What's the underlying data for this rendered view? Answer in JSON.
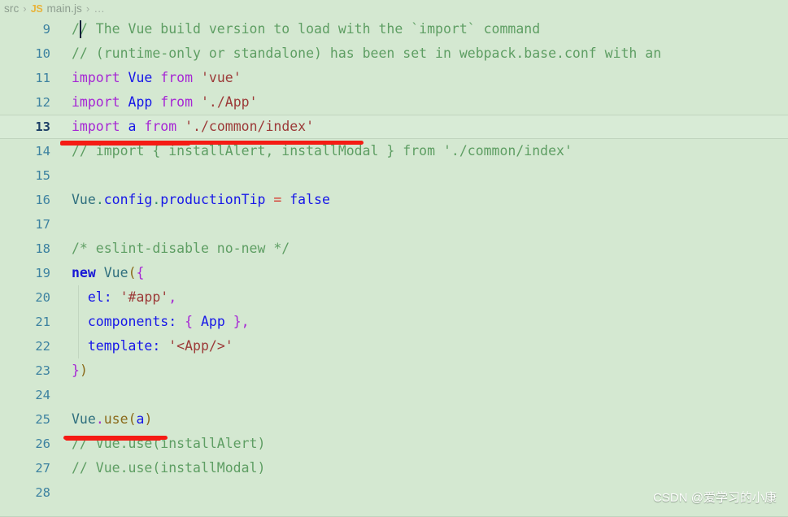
{
  "breadcrumb": {
    "folder": "src",
    "separator": "›",
    "file_icon_label": "JS",
    "file": "main.js",
    "dots": "…"
  },
  "editor": {
    "background_color": "#d4e8d1",
    "active_line_number": 13,
    "first_visible_line": 9,
    "last_visible_line": 28,
    "language": "javascript",
    "cursor": {
      "line": 13,
      "column": 2
    },
    "colors": {
      "comment": "#5e9e63",
      "keyword": "#a626d4",
      "identifier": "#1717e8",
      "string": "#9c3a38",
      "operator": "#d63a2f",
      "paren": "#8a6a1a",
      "line_number": "#3d82a0",
      "annotation_red": "#f51b14"
    },
    "lines": [
      {
        "number": "9",
        "tokens": [
          {
            "text": "// The Vue build version to load with the `import` command",
            "cls": "t-comment"
          }
        ]
      },
      {
        "number": "10",
        "tokens": [
          {
            "text": "// (runtime-only or standalone) has been set in webpack.base.conf with an",
            "cls": "t-comment"
          }
        ]
      },
      {
        "number": "11",
        "tokens": [
          {
            "text": "import",
            "cls": "t-keyword"
          },
          {
            "text": " ",
            "cls": "t-plain"
          },
          {
            "text": "Vue",
            "cls": "t-ident"
          },
          {
            "text": " ",
            "cls": "t-plain"
          },
          {
            "text": "from",
            "cls": "t-keyword"
          },
          {
            "text": " ",
            "cls": "t-plain"
          },
          {
            "text": "'vue'",
            "cls": "t-string"
          }
        ]
      },
      {
        "number": "12",
        "tokens": [
          {
            "text": "import",
            "cls": "t-keyword"
          },
          {
            "text": " ",
            "cls": "t-plain"
          },
          {
            "text": "App",
            "cls": "t-ident"
          },
          {
            "text": " ",
            "cls": "t-plain"
          },
          {
            "text": "from",
            "cls": "t-keyword"
          },
          {
            "text": " ",
            "cls": "t-plain"
          },
          {
            "text": "'./App'",
            "cls": "t-string"
          }
        ]
      },
      {
        "number": "13",
        "active": true,
        "tokens": [
          {
            "text": "import",
            "cls": "t-keyword"
          },
          {
            "text": " ",
            "cls": "t-plain"
          },
          {
            "text": "a",
            "cls": "t-ident"
          },
          {
            "text": " ",
            "cls": "t-plain"
          },
          {
            "text": "from",
            "cls": "t-keyword"
          },
          {
            "text": " ",
            "cls": "t-plain"
          },
          {
            "text": "'./common/index'",
            "cls": "t-string"
          }
        ]
      },
      {
        "number": "14",
        "tokens": [
          {
            "text": "// import { installAlert, installModal } from './common/index'",
            "cls": "t-comment"
          }
        ]
      },
      {
        "number": "15",
        "tokens": []
      },
      {
        "number": "16",
        "tokens": [
          {
            "text": "Vue",
            "cls": "t-member"
          },
          {
            "text": ".",
            "cls": "t-dot"
          },
          {
            "text": "config",
            "cls": "t-ident"
          },
          {
            "text": ".",
            "cls": "t-dot"
          },
          {
            "text": "productionTip",
            "cls": "t-ident"
          },
          {
            "text": " ",
            "cls": "t-plain"
          },
          {
            "text": "=",
            "cls": "t-op"
          },
          {
            "text": " ",
            "cls": "t-plain"
          },
          {
            "text": "false",
            "cls": "t-ident"
          }
        ]
      },
      {
        "number": "17",
        "tokens": []
      },
      {
        "number": "18",
        "tokens": [
          {
            "text": "/* eslint-disable no-new */",
            "cls": "t-comment"
          }
        ]
      },
      {
        "number": "19",
        "tokens": [
          {
            "text": "new",
            "cls": "t-kw-blue"
          },
          {
            "text": " ",
            "cls": "t-plain"
          },
          {
            "text": "Vue",
            "cls": "t-member"
          },
          {
            "text": "(",
            "cls": "t-paren"
          },
          {
            "text": "{",
            "cls": "t-punc"
          }
        ]
      },
      {
        "number": "20",
        "guide": true,
        "tokens": [
          {
            "text": "  ",
            "cls": "t-plain"
          },
          {
            "text": "el",
            "cls": "t-prop"
          },
          {
            "text": ":",
            "cls": "t-prop"
          },
          {
            "text": " ",
            "cls": "t-plain"
          },
          {
            "text": "'#app'",
            "cls": "t-string"
          },
          {
            "text": ",",
            "cls": "t-punc"
          }
        ]
      },
      {
        "number": "21",
        "guide": true,
        "tokens": [
          {
            "text": "  ",
            "cls": "t-plain"
          },
          {
            "text": "components",
            "cls": "t-prop"
          },
          {
            "text": ":",
            "cls": "t-prop"
          },
          {
            "text": " ",
            "cls": "t-plain"
          },
          {
            "text": "{",
            "cls": "t-punc"
          },
          {
            "text": " ",
            "cls": "t-plain"
          },
          {
            "text": "App",
            "cls": "t-ident"
          },
          {
            "text": " ",
            "cls": "t-plain"
          },
          {
            "text": "}",
            "cls": "t-punc"
          },
          {
            "text": ",",
            "cls": "t-punc"
          }
        ]
      },
      {
        "number": "22",
        "guide": true,
        "tokens": [
          {
            "text": "  ",
            "cls": "t-plain"
          },
          {
            "text": "template",
            "cls": "t-prop"
          },
          {
            "text": ":",
            "cls": "t-prop"
          },
          {
            "text": " ",
            "cls": "t-plain"
          },
          {
            "text": "'<App/>'",
            "cls": "t-string"
          }
        ]
      },
      {
        "number": "23",
        "tokens": [
          {
            "text": "}",
            "cls": "t-punc"
          },
          {
            "text": ")",
            "cls": "t-paren"
          }
        ]
      },
      {
        "number": "24",
        "tokens": []
      },
      {
        "number": "25",
        "tokens": [
          {
            "text": "Vue",
            "cls": "t-member"
          },
          {
            "text": ".",
            "cls": "t-punc"
          },
          {
            "text": "use",
            "cls": "t-fn"
          },
          {
            "text": "(",
            "cls": "t-paren"
          },
          {
            "text": "a",
            "cls": "t-ident"
          },
          {
            "text": ")",
            "cls": "t-paren"
          }
        ]
      },
      {
        "number": "26",
        "tokens": [
          {
            "text": "// Vue.use(installAlert)",
            "cls": "t-comment"
          }
        ]
      },
      {
        "number": "27",
        "tokens": [
          {
            "text": "// Vue.use(installModal)",
            "cls": "t-comment"
          }
        ]
      },
      {
        "number": "28",
        "tokens": []
      }
    ]
  },
  "annotations": [
    {
      "name": "underline-import-a",
      "target_line": 13,
      "color": "#f51b14"
    },
    {
      "name": "underline-vue-use-a",
      "target_line": 25,
      "color": "#f51b14"
    }
  ],
  "watermark": {
    "text": "CSDN @爱学习的小康"
  }
}
